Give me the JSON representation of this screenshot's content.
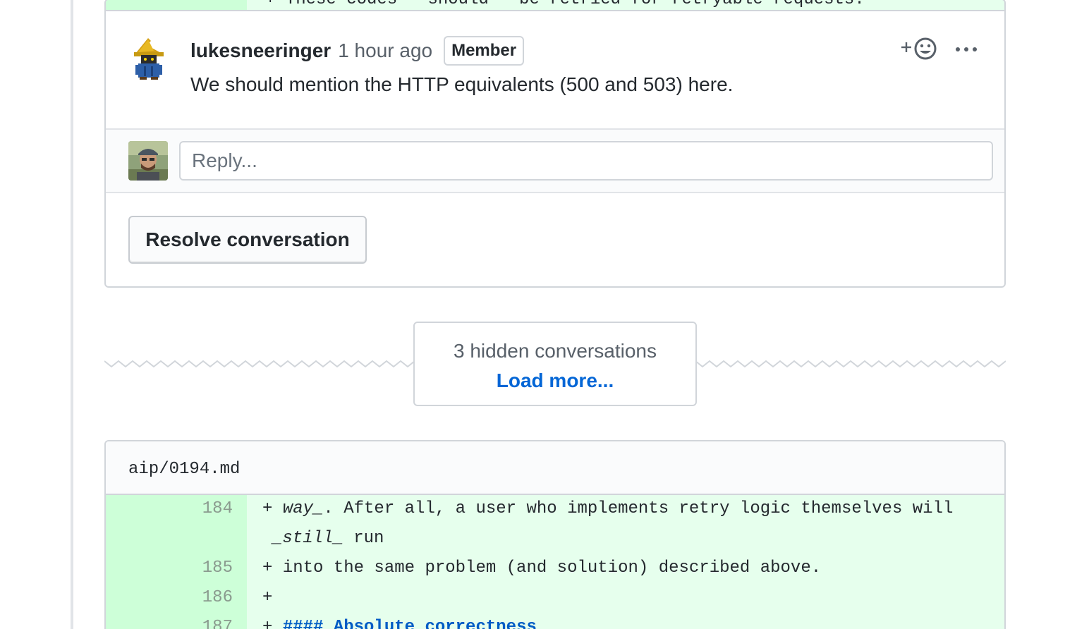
{
  "review_thread": {
    "code_line_above": "+ These codes **should** be retried for retryable requests.",
    "comment": {
      "author": "lukesneeringer",
      "time_ago": "1 hour ago",
      "role_badge": "Member",
      "body": "We should mention the HTTP equivalents (500 and 503) here."
    },
    "reply_placeholder": "Reply...",
    "resolve_button": "Resolve conversation"
  },
  "hidden_conversations": {
    "label": "3 hidden conversations",
    "load_more": "Load more..."
  },
  "file_diff": {
    "path": "aip/0194.md",
    "lines": [
      {
        "number": "184",
        "prefix": "+ ",
        "italic1": "way_",
        "text1": ". After all, a user who implements retry logic themselves will"
      },
      {
        "continuation_italic": "_still_",
        "continuation_text": " run"
      },
      {
        "number": "185",
        "text": "+ into the same problem (and solution) described above."
      },
      {
        "number": "186",
        "text": "+"
      },
      {
        "number": "187",
        "prefix": "+ ",
        "heading": "#### Absolute correctness"
      }
    ]
  },
  "colors": {
    "addition_bg": "#e6ffed",
    "addition_gutter": "#cdffd8",
    "link": "#0366d6",
    "border": "#d1d5da"
  }
}
